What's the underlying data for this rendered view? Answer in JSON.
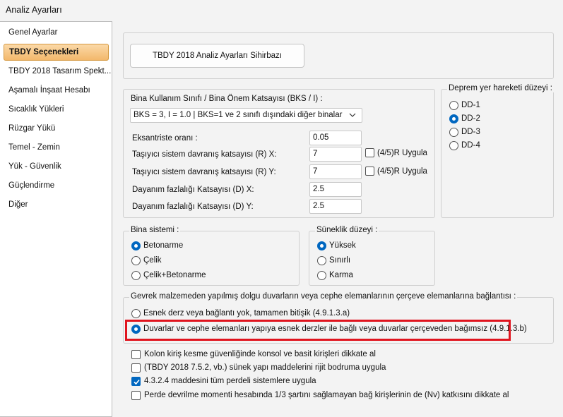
{
  "window": {
    "title": "Analiz Ayarları"
  },
  "sidebar": {
    "items": [
      {
        "label": "Genel Ayarlar",
        "active": false
      },
      {
        "label": "TBDY Seçenekleri",
        "active": true
      },
      {
        "label": "TBDY 2018 Tasarım Spekt...",
        "active": false
      },
      {
        "label": "Aşamalı İnşaat Hesabı",
        "active": false
      },
      {
        "label": "Sıcaklık Yükleri",
        "active": false
      },
      {
        "label": "Rüzgar Yükü",
        "active": false
      },
      {
        "label": "Temel - Zemin",
        "active": false
      },
      {
        "label": "Yük - Güvenlik",
        "active": false
      },
      {
        "label": "Güçlendirme",
        "active": false
      },
      {
        "label": "Diğer",
        "active": false
      }
    ]
  },
  "wizard": {
    "button_label": "TBDY 2018 Analiz Ayarları Sihirbazı"
  },
  "building": {
    "title": "Bina Kullanım Sınıfı / Bina Önem Katsayısı (BKS / I) :",
    "selected": "BKS = 3, I = 1.0 | BKS=1 ve 2 sınıfı dışındaki diğer binalar",
    "fields": [
      {
        "label": "Eksantriste oranı :",
        "value": "0.05"
      },
      {
        "label": "Taşıyıcı sistem davranış katsayısı (R) X:",
        "value": "7",
        "check_label": "(4/5)R Uygula",
        "checked": false
      },
      {
        "label": "Taşıyıcı sistem davranış katsayısı (R) Y:",
        "value": "7",
        "check_label": "(4/5)R Uygula",
        "checked": false
      },
      {
        "label": "Dayanım fazlalığı Katsayısı (D) X:",
        "value": "2.5"
      },
      {
        "label": "Dayanım fazlalığı Katsayısı (D) Y:",
        "value": "2.5"
      }
    ]
  },
  "earthquake": {
    "title": "Deprem yer hareketi düzeyi :",
    "options": [
      "DD-1",
      "DD-2",
      "DD-3",
      "DD-4"
    ],
    "selected_index": 1
  },
  "system": {
    "title": "Bina sistemi :",
    "options": [
      "Betonarme",
      "Çelik",
      "Çelik+Betonarme"
    ],
    "selected_index": 0
  },
  "ductility": {
    "title": "Süneklik düzeyi :",
    "options": [
      "Yüksek",
      "Sınırlı",
      "Karma"
    ],
    "selected_index": 0
  },
  "infill": {
    "title": "Gevrek malzemeden yapılmış dolgu duvarların veya cephe elemanlarının çerçeve elemanlarına bağlantısı :",
    "options": [
      "Esnek derz veya bağlantı yok, tamamen bitişik (4.9.1.3.a)",
      "Duvarlar ve cephe elemanları yapıya esnek derzler ile bağlı veya duvarlar çerçeveden bağımsız (4.9.1.3.b)"
    ],
    "selected_index": 1,
    "highlight_color": "#e0141e"
  },
  "checkboxes": [
    {
      "label": "Kolon kiriş kesme güvenliğinde konsol ve basit kirişleri dikkate al",
      "checked": false
    },
    {
      "label": "(TBDY 2018 7.5.2, vb.) sünek yapı maddelerini rijit bodruma uygula",
      "checked": false
    },
    {
      "label": "4.3.2.4 maddesini tüm perdeli sistemlere uygula",
      "checked": true
    },
    {
      "label": "Perde devrilme momenti hesabında 1/3 şartını sağlamayan bağ kirişlerinin de (Nv) katkısını dikkate al",
      "checked": false
    }
  ],
  "colors": {
    "accent": "#0067c0",
    "sidebar_active": "#f3b86b"
  }
}
